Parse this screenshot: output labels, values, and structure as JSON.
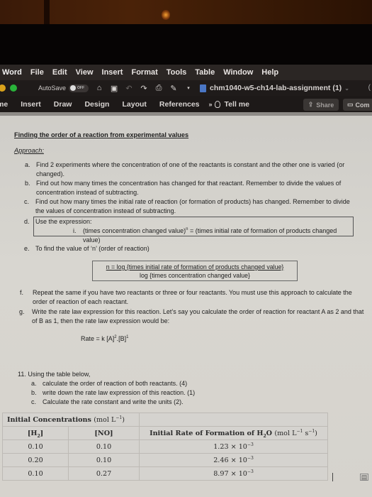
{
  "menu_bar": {
    "app_name": "Word",
    "items": [
      "File",
      "Edit",
      "View",
      "Insert",
      "Format",
      "Tools",
      "Table",
      "Window",
      "Help"
    ]
  },
  "quick_toolbar": {
    "autosave_label": "AutoSave",
    "autosave_state": "OFF",
    "icons": [
      "home-icon",
      "save-icon",
      "undo-icon",
      "redo-icon",
      "print-icon",
      "edit-doc-icon",
      "customize-dropdown-icon"
    ],
    "document_title": "chm1040-w5-ch14-lab-assignment (1)"
  },
  "ribbon": {
    "tabs": [
      "me",
      "Insert",
      "Draw",
      "Design",
      "Layout",
      "References"
    ],
    "more_label": "»",
    "tell_me_label": "Tell me",
    "share_label": "Share",
    "comments_label": "Com"
  },
  "document": {
    "heading": "Finding the order of a reaction from experimental values",
    "approach_label": "Approach:",
    "steps": [
      {
        "marker": "a.",
        "text": "Find 2 experiments where the concentration of one of the reactants is constant and the other one is varied (or changed)."
      },
      {
        "marker": "b.",
        "text": "Find out how many times the concentration has changed for that reactant. Remember to divide the values of concentration instead of subtracting."
      },
      {
        "marker": "c.",
        "text": "Find out how many times the initial rate of reaction (or formation of products) has changed. Remember to divide the values of concentration instead of subtracting."
      },
      {
        "marker": "d.",
        "text": "Use the expression:"
      },
      {
        "marker": "e.",
        "text": "To find the value of ‘n’ (order of reaction)"
      },
      {
        "marker": "f.",
        "text": "Repeat the same if you have two reactants or three or four reactants. You must use this approach to calculate the order of reaction of each reactant."
      },
      {
        "marker": "g.",
        "text": "Write the rate law expression for this reaction.  Let’s say you calculate the order of reaction for reactant A as 2 and that of B as 1, then the rate law expression would be:"
      }
    ],
    "substep_d": {
      "marker": "i.",
      "text_before_sup": "(times concentration changed value)",
      "sup": "n",
      "text_after_sup": " = (times initial rate of formation of products changed value)"
    },
    "formula": {
      "numerator": "n = log {times initial rate of formation of products changed value}",
      "denominator": "log {times concentration changed value}"
    },
    "rate_law": {
      "prefix": "Rate = k [A]",
      "exp_a": "2",
      "mid": ".[B]",
      "exp_b": "1"
    },
    "question": {
      "number_text": "11. Using the table below,",
      "parts": [
        {
          "marker": "a.",
          "text": "calculate the order of reaction of both reactants. (4)"
        },
        {
          "marker": "b.",
          "text": "write down the rate law expression of this reaction. (1)"
        },
        {
          "marker": "c.",
          "text": "Calculate the rate constant and write the units (2)."
        }
      ]
    },
    "table": {
      "group_header": "Initial Concentrations",
      "group_unit": "(mol L",
      "group_unit_exp": "−1",
      "col_h2": "[H",
      "col_h2_sub": "2",
      "col_no": "[NO]",
      "col_rate": "Initial Rate of Formation of H",
      "col_rate_sub": "2",
      "col_rate_o": "O",
      "col_rate_unit": "(mol L",
      "col_rate_unit_exp1": "−1",
      "col_rate_unit_s": " s",
      "col_rate_unit_exp2": "−1",
      "rows": [
        {
          "h2": "0.10",
          "no": "0.10",
          "rate_mantissa": "1.23 × 10",
          "rate_exp": "−3"
        },
        {
          "h2": "0.20",
          "no": "0.10",
          "rate_mantissa": "2.46 × 10",
          "rate_exp": "−3"
        },
        {
          "h2": "0.10",
          "no": "0.27",
          "rate_mantissa": "8.97 × 10",
          "rate_exp": "−3"
        }
      ]
    }
  }
}
